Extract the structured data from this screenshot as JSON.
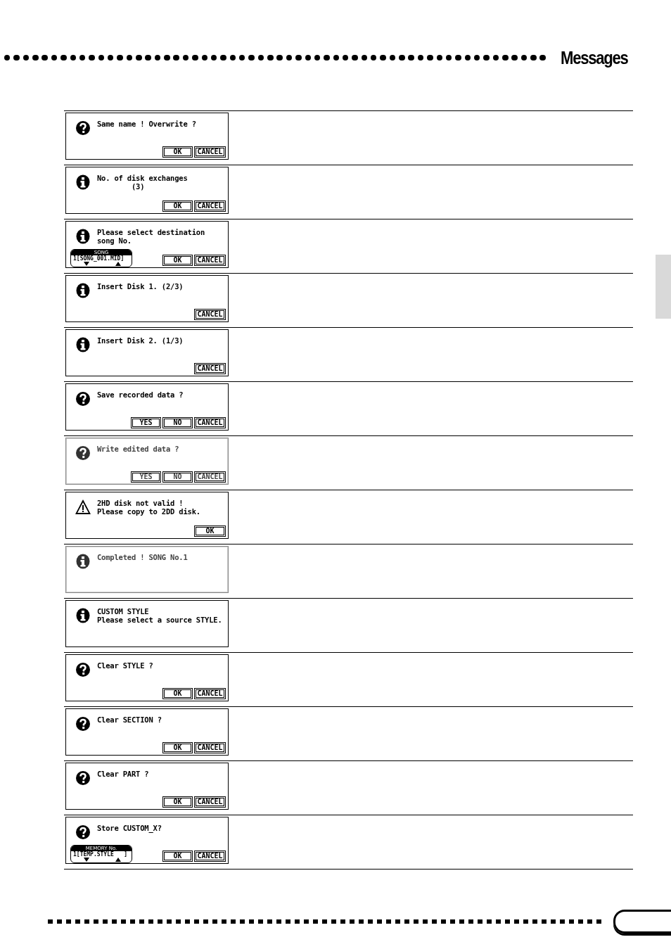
{
  "header": {
    "title": "Messages"
  },
  "messages": [
    {
      "kind": "question",
      "lines": [
        "Same name ! Overwrite ?"
      ],
      "buttons": [
        "OK",
        "CANCEL"
      ],
      "faded": false
    },
    {
      "kind": "info",
      "lines": [
        "No. of disk exchanges",
        "        (3)"
      ],
      "buttons": [
        "OK",
        "CANCEL"
      ],
      "faded": false
    },
    {
      "kind": "info",
      "lines": [
        "Please select destination",
        "song No."
      ],
      "selector": {
        "label": "SONG",
        "value": "1[SONG_001.MID]"
      },
      "buttons": [
        "OK",
        "CANCEL"
      ],
      "faded": false
    },
    {
      "kind": "info",
      "lines": [
        "Insert Disk 1. (2/3)"
      ],
      "buttons": [
        "CANCEL"
      ],
      "faded": false
    },
    {
      "kind": "info",
      "lines": [
        "Insert Disk 2. (1/3)"
      ],
      "buttons": [
        "CANCEL"
      ],
      "faded": false
    },
    {
      "kind": "question",
      "lines": [
        "Save recorded data ?"
      ],
      "buttons": [
        "YES",
        "NO",
        "CANCEL"
      ],
      "faded": false
    },
    {
      "kind": "question",
      "lines": [
        "Write edited data ?"
      ],
      "buttons": [
        "YES",
        "NO",
        "CANCEL"
      ],
      "faded": true
    },
    {
      "kind": "warning",
      "lines": [
        "2HD disk not valid !",
        "Please copy to 2DD disk."
      ],
      "buttons": [
        "OK"
      ],
      "faded": false
    },
    {
      "kind": "info",
      "lines": [
        "Completed ! SONG No.1"
      ],
      "faded": true
    },
    {
      "kind": "info",
      "lines": [
        "CUSTOM STYLE",
        "Please select a source STYLE."
      ],
      "faded": false
    },
    {
      "kind": "question",
      "lines": [
        "Clear STYLE ?"
      ],
      "buttons": [
        "OK",
        "CANCEL"
      ],
      "faded": false
    },
    {
      "kind": "question",
      "lines": [
        "Clear SECTION ?"
      ],
      "buttons": [
        "OK",
        "CANCEL"
      ],
      "faded": false
    },
    {
      "kind": "question",
      "lines": [
        "Clear PART ?"
      ],
      "buttons": [
        "OK",
        "CANCEL"
      ],
      "faded": false
    },
    {
      "kind": "question",
      "lines": [
        "Store CUSTOM_X?"
      ],
      "selector": {
        "label": "MEMORY No.",
        "value": "1[TEMP.STYLE   ]"
      },
      "buttons": [
        "OK",
        "CANCEL"
      ],
      "faded": false
    }
  ]
}
